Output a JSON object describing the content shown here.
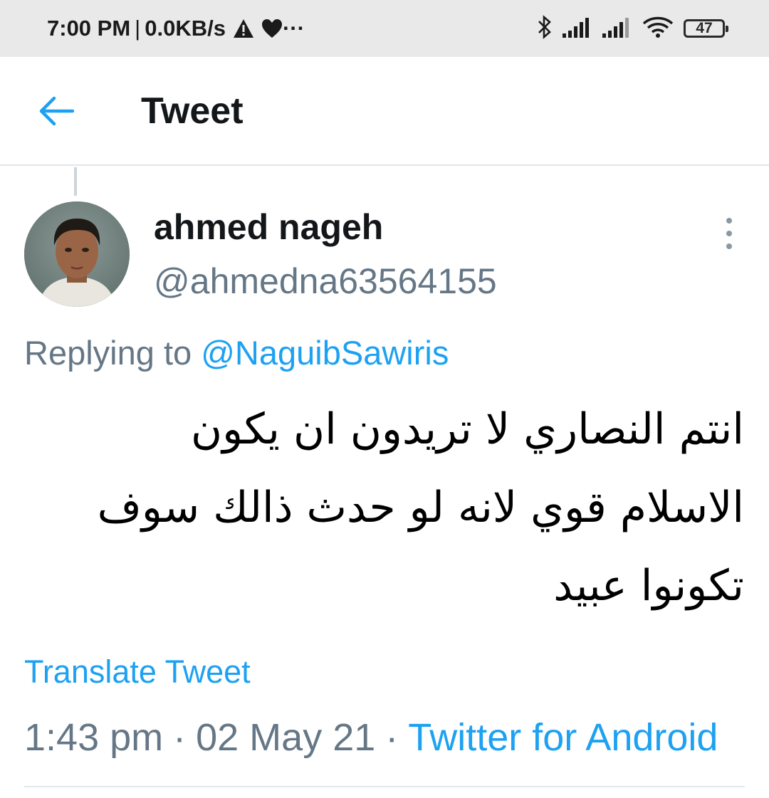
{
  "status_bar": {
    "time": "7:00 PM",
    "separator": "|",
    "network_speed": "0.0KB/s",
    "more_indicator": "···",
    "battery_level": "47",
    "icons": [
      "warning-icon",
      "heart-icon",
      "bluetooth-icon",
      "signal-icon",
      "signal-icon",
      "wifi-icon",
      "battery-icon"
    ]
  },
  "header": {
    "title": "Tweet",
    "back_icon": "arrow-left-icon",
    "accent_color": "#1da1f2"
  },
  "tweet": {
    "display_name": "ahmed nageh",
    "handle": "@ahmedna63564155",
    "replying_prefix": "Replying to",
    "replying_to": "@NaguibSawiris",
    "text": "انتم النصاري لا تريدون ان يكون الاسلام قوي لانه لو حدث ذالك سوف تكونوا عبيد",
    "translate_label": "Translate Tweet",
    "time": "1:43 pm",
    "dot": "·",
    "date": "02 May 21",
    "source": "Twitter for Android"
  }
}
